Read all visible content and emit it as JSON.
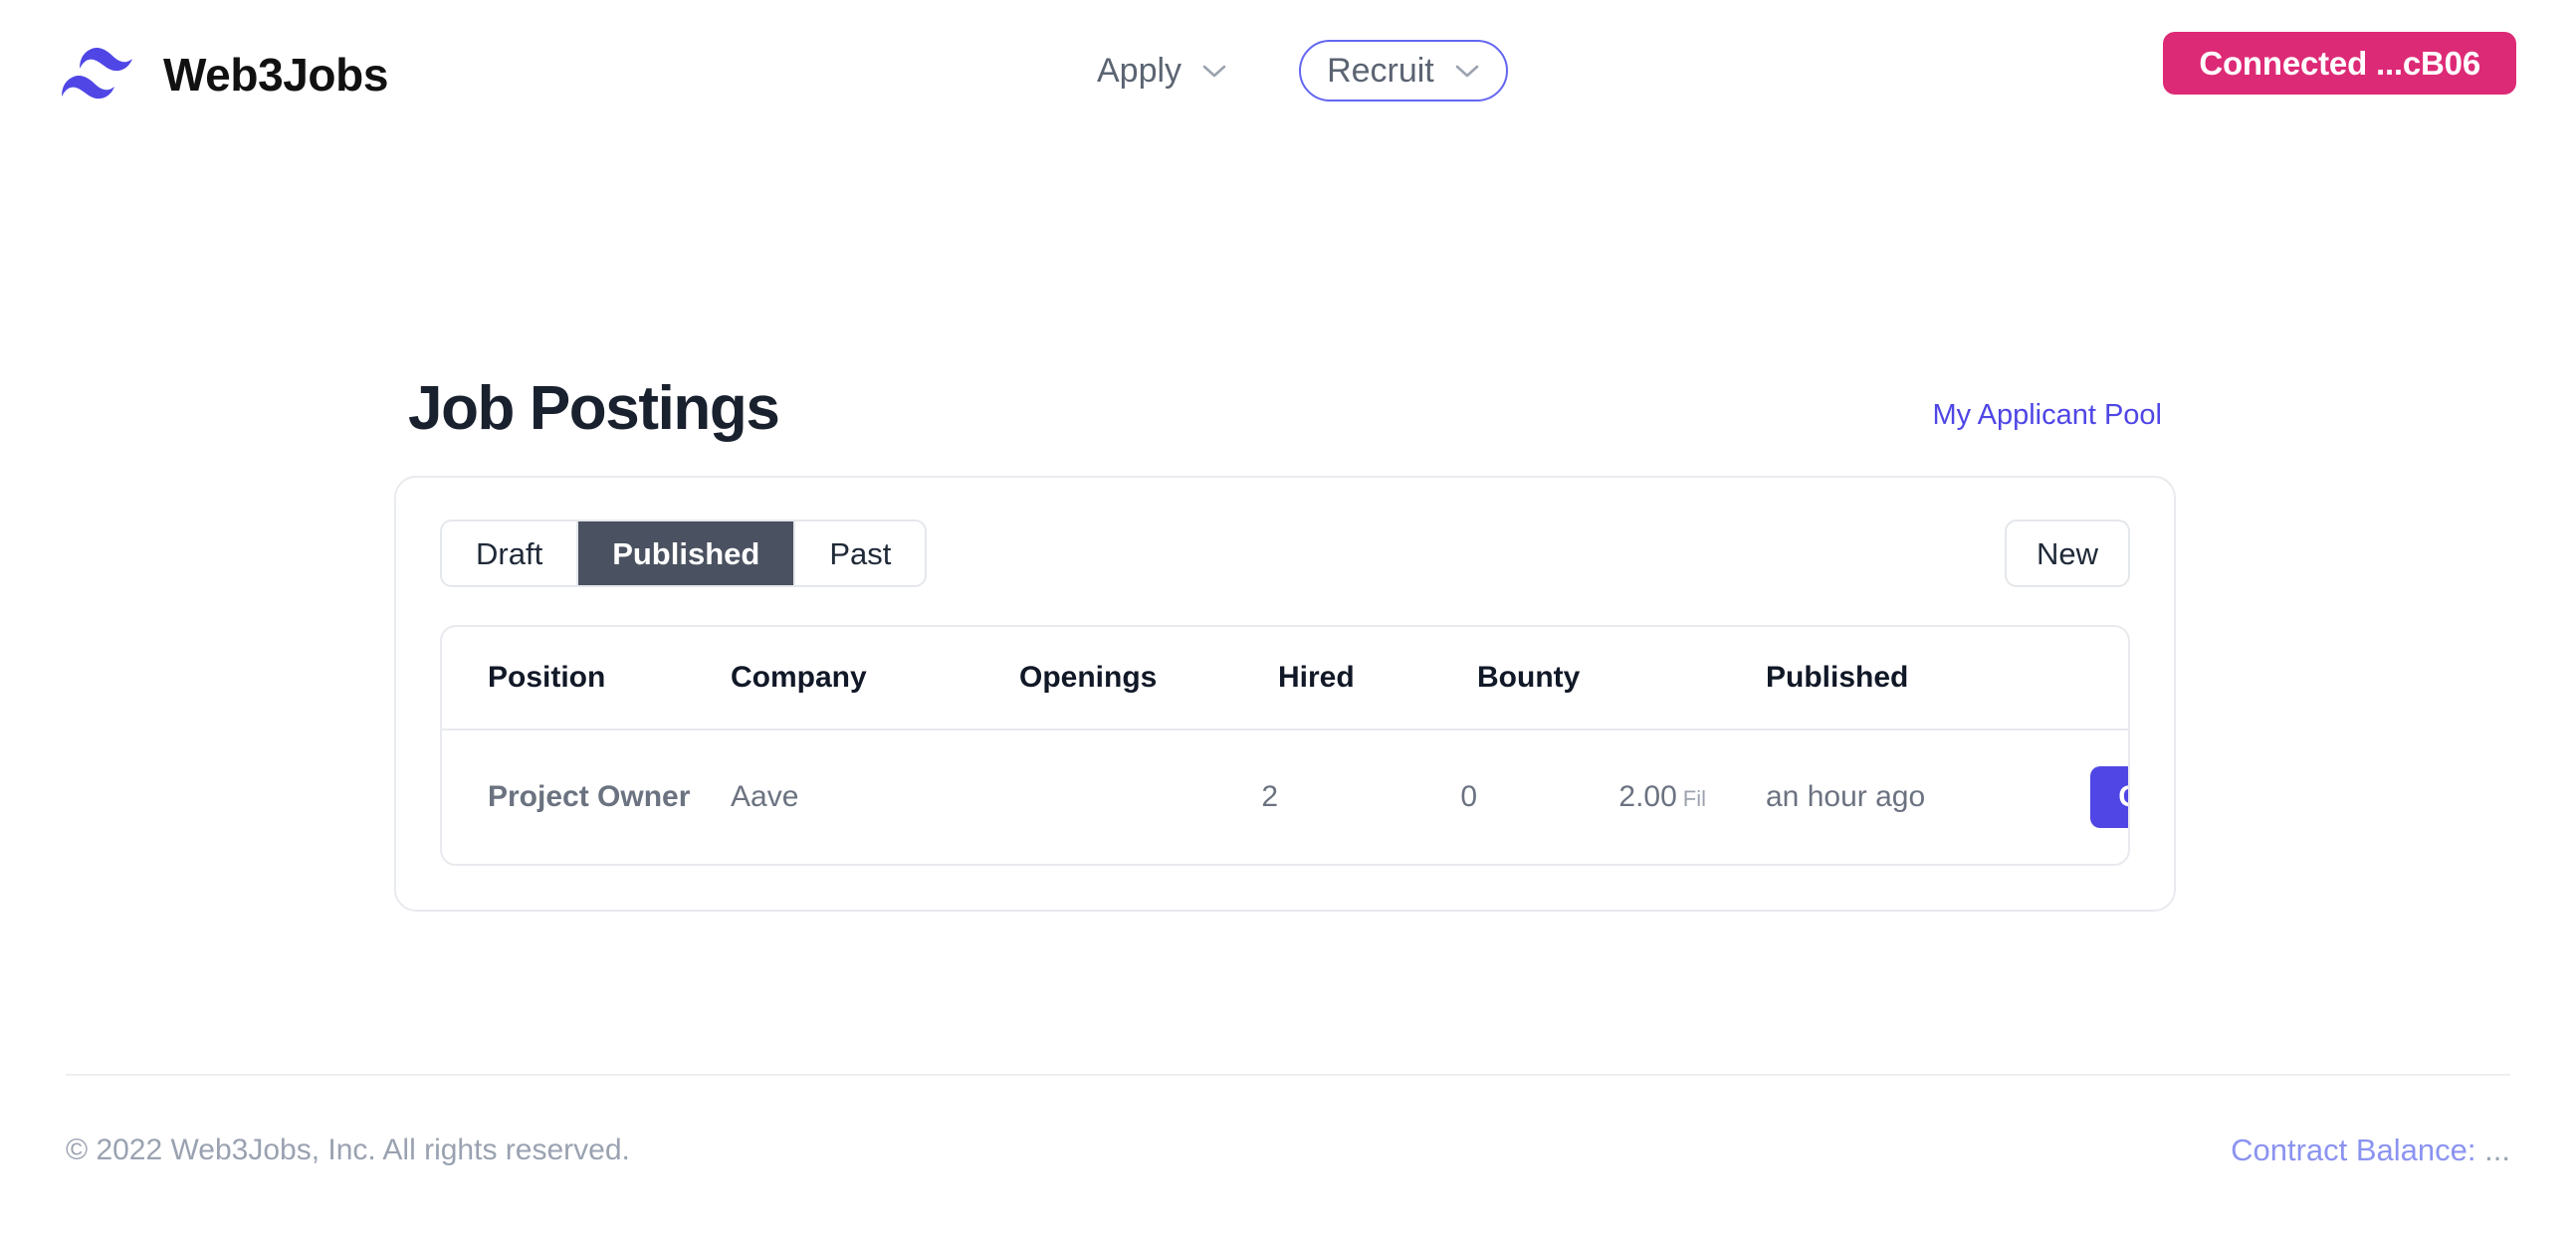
{
  "header": {
    "brand_name": "Web3Jobs",
    "logo_icon": "wave-logo-icon",
    "nav": [
      {
        "label": "Apply",
        "icon": "chevron-down-icon",
        "focused": false
      },
      {
        "label": "Recruit",
        "icon": "chevron-down-icon",
        "focused": true
      }
    ],
    "wallet_button": "Connected ...cB06",
    "accent_pink": "#dd2a76",
    "accent_indigo": "#4f46e5"
  },
  "main": {
    "page_title": "Job Postings",
    "applicant_pool_link": "My Applicant Pool",
    "tabs": [
      {
        "label": "Draft",
        "active": false
      },
      {
        "label": "Published",
        "active": true
      },
      {
        "label": "Past",
        "active": false
      }
    ],
    "new_button": "New",
    "table": {
      "columns": [
        "Position",
        "Company",
        "Openings",
        "Hired",
        "Bounty",
        "Published",
        ""
      ],
      "rows": [
        {
          "position": "Project Owner",
          "company": "Aave",
          "openings": "2",
          "hired": "0",
          "bounty_amount": "2.00",
          "bounty_unit": "Fil",
          "published": "an hour ago",
          "action_label": "Close"
        }
      ]
    }
  },
  "footer": {
    "copyright": "© 2022 Web3Jobs, Inc. All rights reserved.",
    "balance_label": "Contract Balance:",
    "balance_value": "..."
  }
}
